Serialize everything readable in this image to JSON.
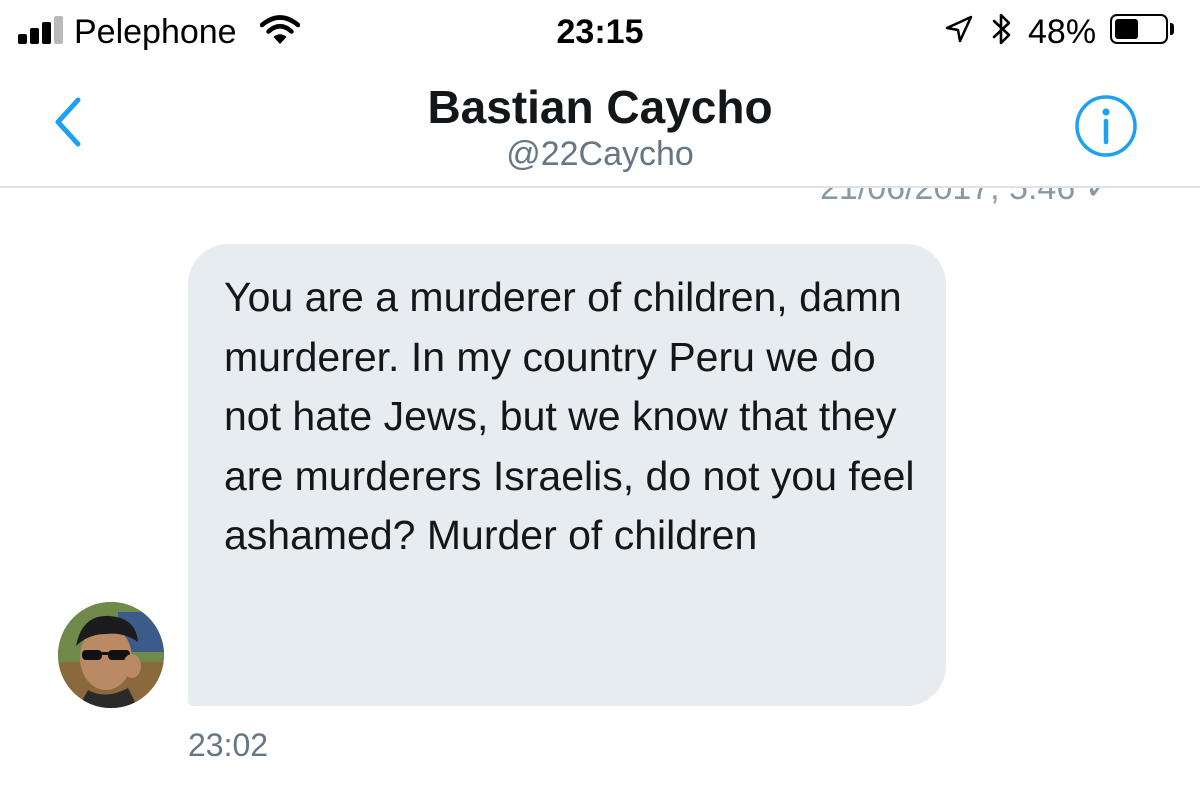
{
  "status_bar": {
    "carrier": "Pelephone",
    "time": "23:15",
    "battery_percent": "48%",
    "battery_level": 0.48,
    "signal_bars_filled": 3,
    "signal_bars_total": 4
  },
  "header": {
    "name": "Bastian Caycho",
    "handle": "@22Caycho",
    "back_icon": "chevron-left-icon",
    "info_icon": "info-icon",
    "accent_color": "#1da1f2"
  },
  "conversation": {
    "previous_timestamp": "21/06/2017, 5:46 ✓",
    "messages": [
      {
        "text": "You are a murderer of children, damn murderer. In my country Peru we do not hate Jews, but we know that they are murderers Israelis, do not you feel ashamed? Murder of children",
        "time": "23:02"
      }
    ]
  },
  "colors": {
    "bubble_bg": "#e6ecf0",
    "timestamp": "#657786",
    "divider": "#dfe3e7"
  }
}
